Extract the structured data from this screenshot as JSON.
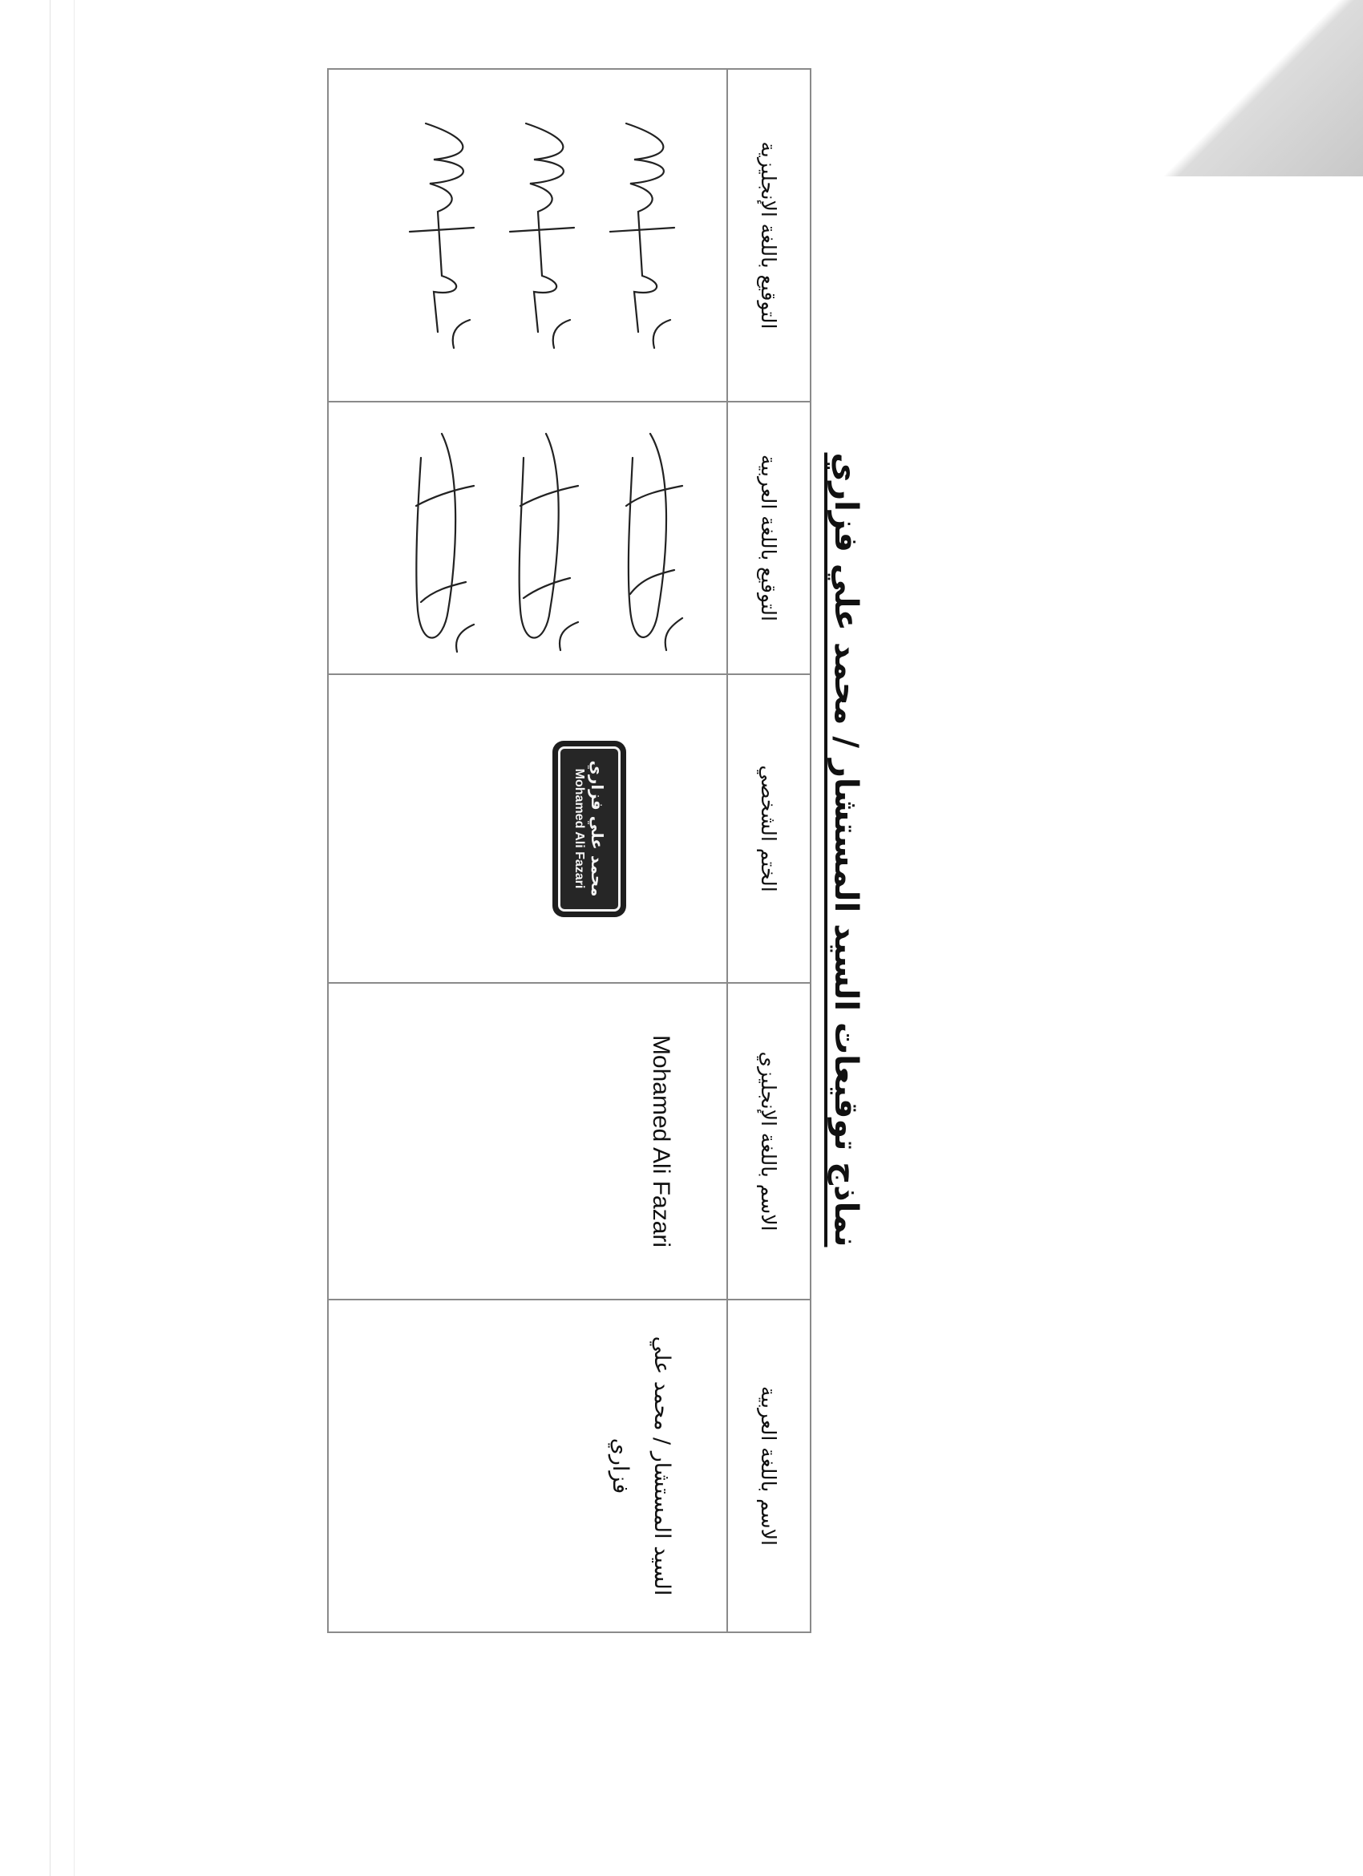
{
  "document": {
    "title": "نماذج توقيعات السيد المستشار / محمد علي فزاري"
  },
  "table": {
    "headers": [
      "الاسم باللغة العربية",
      "الاسم باللغة الإنجليزي",
      "الختم الشخصي",
      "التوقيع باللغة العربية",
      "التوقيع باللغة الإنجليزية"
    ],
    "row": {
      "arabic_name": "السيد المستشار / محمد علي فزاري",
      "english_name": "Mohamed Ali Fazari",
      "stamp": {
        "arabic": "محمد علي فزاري",
        "english": "Mohamed Ali Fazari"
      }
    }
  },
  "colors": {
    "ink": "#111111",
    "border": "#8a8a8a",
    "stamp": "#1e1e1e"
  }
}
